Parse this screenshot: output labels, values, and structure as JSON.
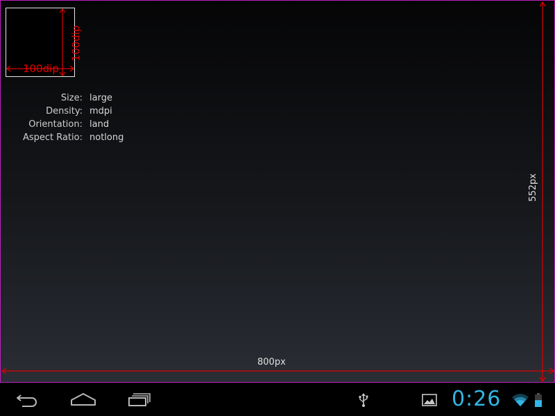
{
  "window": {
    "dip_width_label": "100dip",
    "dip_height_label": "100dip",
    "screen_width_label": "800px",
    "screen_height_label": "552px"
  },
  "info": {
    "rows": [
      {
        "label": "Size:",
        "value": "large"
      },
      {
        "label": "Density:",
        "value": "mdpi"
      },
      {
        "label": "Orientation:",
        "value": "land"
      },
      {
        "label": "Aspect Ratio:",
        "value": "notlong"
      }
    ]
  },
  "status_bar": {
    "time": "0:26",
    "battery_level": 0.55,
    "icons": {
      "back": "back-icon",
      "home": "home-icon",
      "recents": "recent-apps-icon",
      "usb": "usb-icon",
      "gallery": "image-notification-icon",
      "wifi": "wifi-icon",
      "battery": "battery-icon"
    }
  },
  "colors": {
    "accent": "#33b5e5",
    "measure": "#e00000",
    "frame": "#c020c0"
  }
}
